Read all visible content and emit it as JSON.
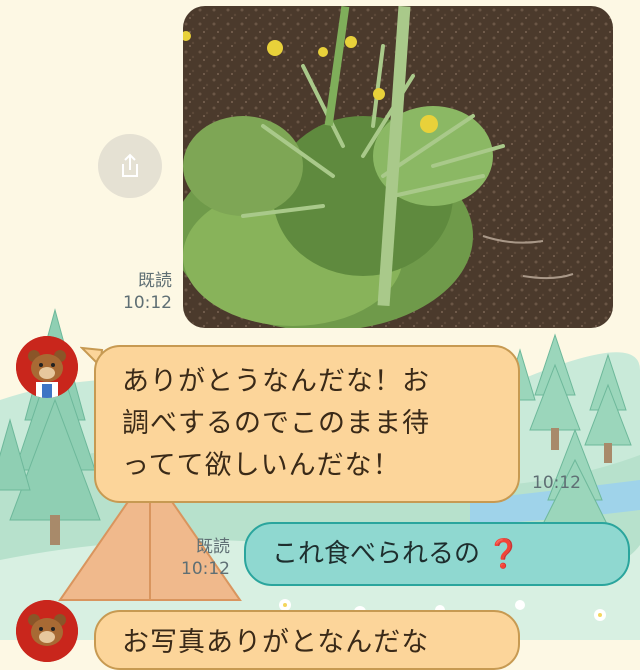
{
  "photo_message": {
    "image_alt": "garden-plant-photo",
    "read_label": "既読",
    "time": "10:12"
  },
  "messages": [
    {
      "direction": "incoming",
      "text_lines": [
        "ありがとうなんだな！お",
        "調べするのでこのまま待",
        "ってて欲しいんだな！"
      ],
      "time": "10:12"
    },
    {
      "direction": "outgoing",
      "text": "これ食べられるの",
      "emoji": "❓",
      "read_label": "既読",
      "time": "10:12"
    },
    {
      "direction": "incoming",
      "text_partial": "お写真ありがとなんだな"
    }
  ],
  "colors": {
    "incoming_bubble": "#fcd59a",
    "outgoing_bubble": "#8fd8d0",
    "avatar_bg": "#c9261c"
  }
}
